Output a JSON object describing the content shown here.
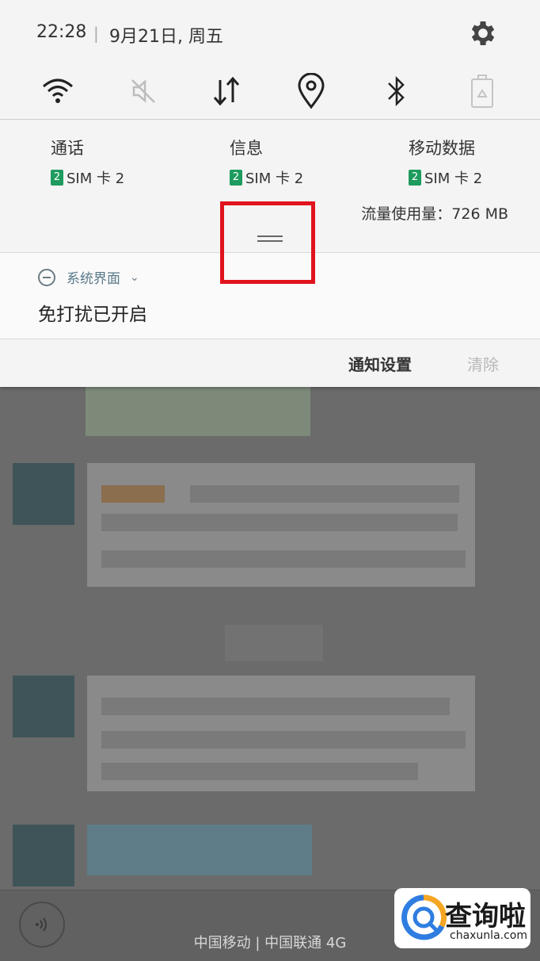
{
  "status_bar": {
    "time": "22:28",
    "date": "9月21日, 周五",
    "settings_icon": "gear-icon"
  },
  "quick_toggles": [
    {
      "icon": "wifi-icon",
      "state": "on"
    },
    {
      "icon": "sound-muted-icon",
      "state": "off"
    },
    {
      "icon": "data-transfer-icon",
      "state": "on"
    },
    {
      "icon": "location-icon",
      "state": "on"
    },
    {
      "icon": "bluetooth-icon",
      "state": "on"
    },
    {
      "icon": "power-saving-icon",
      "state": "off"
    }
  ],
  "sim_panel": {
    "calls": {
      "title": "通话",
      "sim_badge": "2",
      "sim": "SIM 卡 2"
    },
    "messages": {
      "title": "信息",
      "sim_badge": "2",
      "sim": "SIM 卡 2"
    },
    "mobile_data": {
      "title": "移动数据",
      "sim_badge": "2",
      "sim": "SIM 卡 2"
    },
    "usage": "流量使用量：726 MB"
  },
  "notification": {
    "app": "系统界面",
    "title": "免打扰已开启"
  },
  "actions": {
    "settings": "通知设置",
    "clear": "清除"
  },
  "bottom": {
    "carrier": "中国移动 | 中国联通 4G"
  },
  "watermark": {
    "brand": "查询啦",
    "domain": "chaxunla.com"
  },
  "colors": {
    "highlight": "#e0141e",
    "sim_badge": "#1e9b5e",
    "shade_bg": "#f4f4f4"
  }
}
